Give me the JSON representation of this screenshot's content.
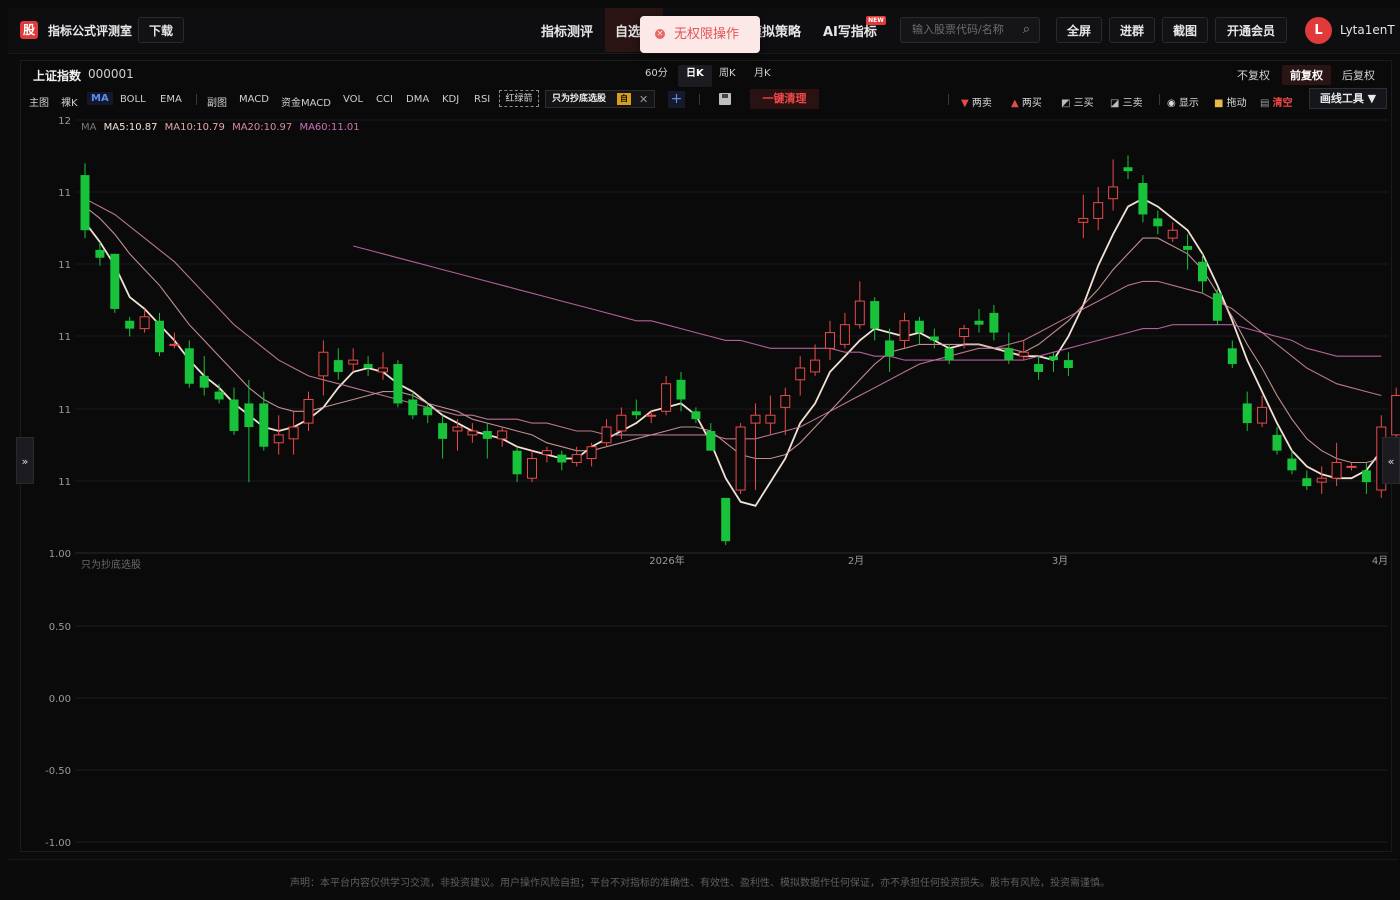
{
  "app": {
    "logo": "股",
    "title": "指标公式评测室",
    "download": "下载"
  },
  "nav": [
    {
      "label": "指标测评"
    },
    {
      "label": "自选"
    },
    {
      "label": "模拟策略"
    },
    {
      "label": "AI写指标",
      "badge": "NEW"
    }
  ],
  "search": {
    "placeholder": "输入股票代码/名称"
  },
  "header_buttons": [
    "全屏",
    "进群",
    "截图",
    "开通会员"
  ],
  "user": {
    "initial": "L",
    "name": "Lyta1enT"
  },
  "toast": {
    "message": "无权限操作"
  },
  "stock": {
    "name": "上证指数",
    "code": "000001"
  },
  "periods": [
    {
      "label": "60分"
    },
    {
      "label": "日K",
      "active": true
    },
    {
      "label": "周K"
    },
    {
      "label": "月K"
    }
  ],
  "adjust": [
    {
      "label": "不复权"
    },
    {
      "label": "前复权",
      "active": true
    },
    {
      "label": "后复权"
    }
  ],
  "indicators": {
    "main": "主图",
    "items": [
      "裸K",
      "MA",
      "BOLL",
      "EMA"
    ],
    "active": "MA",
    "sub_label": "副图",
    "sub_items": [
      "MACD",
      "资金MACD",
      "VOL",
      "CCI",
      "DMA",
      "KDJ",
      "RSI"
    ],
    "red_green": "红绿箭",
    "screener": "只为抄底选股",
    "screener_tag": "自",
    "clear_all": "一键清理"
  },
  "draw_tools": [
    {
      "label": "两卖",
      "icon": "down-triangle-icon"
    },
    {
      "label": "两买",
      "icon": "up-triangle-icon"
    },
    {
      "label": "三买",
      "icon": "rise-line-icon"
    },
    {
      "label": "三卖",
      "icon": "fall-line-icon"
    },
    {
      "label": "显示",
      "icon": "eye-icon"
    },
    {
      "label": "拖动",
      "icon": "lock-icon"
    },
    {
      "label": "清空",
      "icon": "trash-icon"
    }
  ],
  "draw_tool_menu": "画线工具 ▼",
  "ma_legend": [
    {
      "label": "MA",
      "color": "#777777"
    },
    {
      "label": "MA5:10.87",
      "color": "#f2e2d4"
    },
    {
      "label": "MA10:10.79",
      "color": "#e0a8a8"
    },
    {
      "label": "MA20:10.97",
      "color": "#d788a6"
    },
    {
      "label": "MA60:11.01",
      "color": "#d070b0"
    }
  ],
  "sub_panel_label": "只为抄底选股",
  "colors": {
    "up": "#e84a4a",
    "down": "#18c23a",
    "accent": "#e03a3a",
    "link": "#5c8cf2"
  },
  "chart_data": [
    {
      "type": "candlestick",
      "y_ticks": [
        "12",
        "11",
        "11",
        "11",
        "11",
        "11"
      ],
      "x_ticks": [
        "2026年",
        "2月",
        "3月",
        "4月"
      ],
      "candles": [
        [
          11.16,
          11.02,
          11.19,
          11.0
        ],
        [
          10.97,
          10.95,
          10.99,
          10.93
        ],
        [
          10.96,
          10.82,
          10.96,
          10.81
        ],
        [
          10.79,
          10.77,
          10.8,
          10.75
        ],
        [
          10.77,
          10.8,
          10.82,
          10.76
        ],
        [
          10.79,
          10.71,
          10.81,
          10.7
        ],
        [
          10.73,
          10.73,
          10.76,
          10.72
        ],
        [
          10.72,
          10.63,
          10.74,
          10.62
        ],
        [
          10.65,
          10.62,
          10.7,
          10.6
        ],
        [
          10.61,
          10.59,
          10.63,
          10.58
        ],
        [
          10.59,
          10.51,
          10.62,
          10.5
        ],
        [
          10.58,
          10.52,
          10.64,
          10.38
        ],
        [
          10.58,
          10.47,
          10.61,
          10.46
        ],
        [
          10.48,
          10.5,
          10.55,
          10.45
        ],
        [
          10.49,
          10.52,
          10.56,
          10.45
        ],
        [
          10.53,
          10.59,
          10.61,
          10.51
        ],
        [
          10.65,
          10.71,
          10.74,
          10.6
        ],
        [
          10.69,
          10.66,
          10.72,
          10.64
        ],
        [
          10.68,
          10.69,
          10.72,
          10.66
        ],
        [
          10.68,
          10.67,
          10.7,
          10.65
        ],
        [
          10.66,
          10.67,
          10.71,
          10.64
        ],
        [
          10.68,
          10.58,
          10.69,
          10.57
        ],
        [
          10.59,
          10.55,
          10.61,
          10.54
        ],
        [
          10.57,
          10.55,
          10.58,
          10.53
        ],
        [
          10.53,
          10.49,
          10.55,
          10.44
        ],
        [
          10.51,
          10.52,
          10.54,
          10.46
        ],
        [
          10.5,
          10.51,
          10.53,
          10.48
        ],
        [
          10.51,
          10.49,
          10.53,
          10.44
        ],
        [
          10.49,
          10.51,
          10.52,
          10.47
        ],
        [
          10.46,
          10.4,
          10.47,
          10.38
        ],
        [
          10.39,
          10.44,
          10.46,
          10.38
        ],
        [
          10.45,
          10.46,
          10.47,
          10.43
        ],
        [
          10.45,
          10.43,
          10.46,
          10.41
        ],
        [
          10.43,
          10.45,
          10.47,
          10.42
        ],
        [
          10.44,
          10.47,
          10.48,
          10.42
        ],
        [
          10.48,
          10.52,
          10.54,
          10.47
        ],
        [
          10.51,
          10.55,
          10.57,
          10.49
        ],
        [
          10.56,
          10.55,
          10.59,
          10.54
        ],
        [
          10.55,
          10.55,
          10.56,
          10.53
        ],
        [
          10.56,
          10.63,
          10.65,
          10.55
        ],
        [
          10.64,
          10.59,
          10.66,
          10.56
        ],
        [
          10.56,
          10.54,
          10.57,
          10.53
        ],
        [
          10.51,
          10.46,
          10.53,
          10.46
        ],
        [
          10.34,
          10.23,
          10.34,
          10.22
        ],
        [
          10.36,
          10.52,
          10.53,
          10.35
        ],
        [
          10.53,
          10.55,
          10.58,
          10.36
        ],
        [
          10.53,
          10.55,
          10.6,
          10.5
        ],
        [
          10.57,
          10.6,
          10.62,
          10.5
        ],
        [
          10.64,
          10.67,
          10.7,
          10.6
        ],
        [
          10.66,
          10.69,
          10.73,
          10.65
        ],
        [
          10.72,
          10.76,
          10.79,
          10.69
        ],
        [
          10.73,
          10.78,
          10.81,
          10.72
        ],
        [
          10.78,
          10.84,
          10.89,
          10.77
        ],
        [
          10.84,
          10.77,
          10.85,
          10.74
        ],
        [
          10.74,
          10.7,
          10.77,
          10.66
        ],
        [
          10.74,
          10.79,
          10.81,
          10.72
        ],
        [
          10.79,
          10.76,
          10.8,
          10.73
        ],
        [
          10.75,
          10.74,
          10.77,
          10.72
        ],
        [
          10.72,
          10.69,
          10.73,
          10.68
        ],
        [
          10.75,
          10.77,
          10.78,
          10.72
        ],
        [
          10.79,
          10.78,
          10.82,
          10.76
        ],
        [
          10.81,
          10.76,
          10.83,
          10.74
        ],
        [
          10.72,
          10.69,
          10.76,
          10.68
        ],
        [
          10.7,
          10.71,
          10.74,
          10.69
        ],
        [
          10.68,
          10.66,
          10.7,
          10.64
        ],
        [
          10.7,
          10.69,
          10.71,
          10.66
        ],
        [
          10.69,
          10.67,
          10.71,
          10.65
        ],
        [
          11.04,
          11.05,
          11.11,
          11.0
        ],
        [
          11.05,
          11.09,
          11.13,
          11.02
        ],
        [
          11.1,
          11.13,
          11.2,
          11.07
        ],
        [
          11.18,
          11.17,
          11.21,
          11.15
        ],
        [
          11.14,
          11.06,
          11.16,
          11.04
        ],
        [
          11.05,
          11.03,
          11.07,
          11.01
        ],
        [
          11.0,
          11.02,
          11.04,
          10.99
        ],
        [
          10.98,
          10.97,
          11.01,
          10.92
        ],
        [
          10.94,
          10.89,
          10.96,
          10.86
        ],
        [
          10.86,
          10.79,
          10.87,
          10.78
        ],
        [
          10.72,
          10.68,
          10.74,
          10.67
        ],
        [
          10.58,
          10.53,
          10.61,
          10.51
        ],
        [
          10.53,
          10.57,
          10.6,
          10.52
        ],
        [
          10.5,
          10.46,
          10.52,
          10.45
        ],
        [
          10.44,
          10.41,
          10.46,
          10.4
        ],
        [
          10.39,
          10.37,
          10.41,
          10.36
        ],
        [
          10.38,
          10.39,
          10.42,
          10.35
        ],
        [
          10.39,
          10.43,
          10.48,
          10.37
        ],
        [
          10.42,
          10.42,
          10.43,
          10.41
        ],
        [
          10.41,
          10.38,
          10.43,
          10.35
        ],
        [
          10.36,
          10.52,
          10.55,
          10.34
        ],
        [
          10.5,
          10.6,
          10.62,
          10.47
        ]
      ],
      "ma_series": [
        {
          "name": "MA5",
          "color": "#f2e2d4",
          "values": [
            11.04,
            10.99,
            10.93,
            10.85,
            10.82,
            10.78,
            10.74,
            10.69,
            10.65,
            10.62,
            10.58,
            10.55,
            10.52,
            10.51,
            10.52,
            10.54,
            10.57,
            10.62,
            10.66,
            10.67,
            10.66,
            10.63,
            10.61,
            10.58,
            10.55,
            10.53,
            10.51,
            10.5,
            10.49,
            10.47,
            10.46,
            10.45,
            10.44,
            10.44,
            10.47,
            10.49,
            10.51,
            10.53,
            10.56,
            10.57,
            10.58,
            10.55,
            10.48,
            10.39,
            10.33,
            10.32,
            10.38,
            10.44,
            10.53,
            10.58,
            10.66,
            10.7,
            10.74,
            10.77,
            10.76,
            10.75,
            10.76,
            10.74,
            10.72,
            10.73,
            10.73,
            10.72,
            10.71,
            10.7,
            10.7,
            10.69,
            10.75,
            10.83,
            10.93,
            11.01,
            11.08,
            11.1,
            11.08,
            11.05,
            11.02,
            10.96,
            10.88,
            10.79,
            10.69,
            10.61,
            10.53,
            10.46,
            10.42,
            10.4,
            10.39,
            10.39,
            10.41,
            10.46
          ]
        },
        {
          "name": "MA10",
          "color": "#e0a8a8",
          "values": [
            11.08,
            11.05,
            11.01,
            10.96,
            10.92,
            10.88,
            10.83,
            10.78,
            10.74,
            10.7,
            10.66,
            10.62,
            10.59,
            10.57,
            10.56,
            10.56,
            10.57,
            10.58,
            10.59,
            10.6,
            10.61,
            10.61,
            10.6,
            10.58,
            10.57,
            10.56,
            10.54,
            10.53,
            10.52,
            10.51,
            10.5,
            10.48,
            10.47,
            10.46,
            10.46,
            10.47,
            10.48,
            10.49,
            10.5,
            10.51,
            10.52,
            10.52,
            10.51,
            10.48,
            10.45,
            10.44,
            10.44,
            10.45,
            10.48,
            10.52,
            10.56,
            10.6,
            10.64,
            10.68,
            10.71,
            10.72,
            10.73,
            10.73,
            10.73,
            10.73,
            10.73,
            10.72,
            10.72,
            10.71,
            10.73,
            10.76,
            10.79,
            10.83,
            10.87,
            10.92,
            10.96,
            11.0,
            11.0,
            10.98,
            10.96,
            10.92,
            10.86,
            10.8,
            10.73,
            10.67,
            10.6,
            10.54,
            10.49,
            10.46,
            10.44,
            10.43,
            10.43,
            10.44
          ]
        },
        {
          "name": "MA20",
          "color": "#d788a6",
          "values": [
            11.1,
            11.08,
            11.06,
            11.03,
            11.0,
            10.97,
            10.94,
            10.9,
            10.86,
            10.82,
            10.78,
            10.75,
            10.72,
            10.69,
            10.67,
            10.65,
            10.64,
            10.63,
            10.62,
            10.61,
            10.6,
            10.59,
            10.58,
            10.57,
            10.56,
            10.55,
            10.55,
            10.54,
            10.54,
            10.54,
            10.53,
            10.53,
            10.52,
            10.51,
            10.51,
            10.5,
            10.5,
            10.5,
            10.5,
            10.5,
            10.5,
            10.5,
            10.5,
            10.49,
            10.49,
            10.49,
            10.5,
            10.51,
            10.52,
            10.54,
            10.56,
            10.58,
            10.6,
            10.62,
            10.64,
            10.66,
            10.68,
            10.69,
            10.7,
            10.71,
            10.72,
            10.72,
            10.73,
            10.74,
            10.76,
            10.78,
            10.8,
            10.82,
            10.84,
            10.86,
            10.88,
            10.89,
            10.89,
            10.88,
            10.87,
            10.86,
            10.84,
            10.82,
            10.79,
            10.76,
            10.73,
            10.7,
            10.67,
            10.65,
            10.63,
            10.62,
            10.61,
            10.6
          ]
        },
        {
          "name": "MA60",
          "color": "#d070b0",
          "values": [
            null,
            null,
            null,
            null,
            null,
            null,
            null,
            null,
            null,
            null,
            null,
            null,
            null,
            null,
            null,
            null,
            null,
            null,
            10.98,
            10.97,
            10.96,
            10.95,
            10.94,
            10.93,
            10.92,
            10.91,
            10.9,
            10.89,
            10.88,
            10.87,
            10.86,
            10.85,
            10.84,
            10.83,
            10.82,
            10.81,
            10.8,
            10.79,
            10.79,
            10.78,
            10.77,
            10.76,
            10.75,
            10.74,
            10.74,
            10.73,
            10.72,
            10.72,
            10.72,
            10.72,
            10.72,
            10.71,
            10.71,
            10.7,
            10.7,
            10.69,
            10.69,
            10.69,
            10.69,
            10.69,
            10.69,
            10.69,
            10.69,
            10.69,
            10.7,
            10.71,
            10.72,
            10.73,
            10.74,
            10.75,
            10.76,
            10.77,
            10.77,
            10.78,
            10.78,
            10.78,
            10.78,
            10.78,
            10.77,
            10.76,
            10.75,
            10.74,
            10.72,
            10.71,
            10.7,
            10.7,
            10.7,
            10.7
          ]
        }
      ]
    },
    {
      "type": "line",
      "y_ticks": [
        "1.00",
        "0.50",
        "0.00",
        "-0.50",
        "-1.00"
      ],
      "series": []
    }
  ],
  "disclaimer": "声明：本平台内容仅供学习交流，非投资建议。用户操作风险自担；平台不对指标的准确性、有效性、盈利性、模拟数据作任何保证，亦不承担任何投资损失。股市有风险，投资需谨慎。"
}
